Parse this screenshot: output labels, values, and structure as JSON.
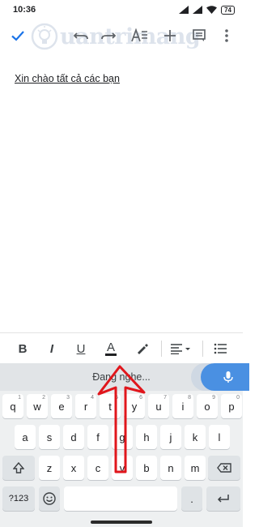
{
  "status_bar": {
    "time": "10:36",
    "battery": "74",
    "icons": [
      "signal-icon",
      "signal-icon",
      "wifi-icon",
      "battery-icon"
    ]
  },
  "toolbar": {
    "icons": [
      "check-icon",
      "undo-icon",
      "redo-icon",
      "text-format-icon",
      "add-icon",
      "comment-icon",
      "more-vert-icon"
    ]
  },
  "watermark": {
    "text": "uantrimang"
  },
  "document": {
    "text": "Xin chào tất cả các bạn"
  },
  "format_bar": {
    "bold": "B",
    "italic": "I",
    "underline": "U",
    "text_color": "A",
    "icons": [
      "highlight-pen-icon",
      "align-icon",
      "list-icon"
    ]
  },
  "keyboard": {
    "voice_status": "Đang nghe...",
    "row1": [
      {
        "key": "q",
        "hint": "1"
      },
      {
        "key": "w",
        "hint": "2"
      },
      {
        "key": "e",
        "hint": "3"
      },
      {
        "key": "r",
        "hint": "4"
      },
      {
        "key": "t",
        "hint": "5"
      },
      {
        "key": "y",
        "hint": "6"
      },
      {
        "key": "u",
        "hint": "7"
      },
      {
        "key": "i",
        "hint": "8"
      },
      {
        "key": "o",
        "hint": "9"
      },
      {
        "key": "p",
        "hint": "0"
      }
    ],
    "row2": [
      "a",
      "s",
      "d",
      "f",
      "g",
      "h",
      "j",
      "k",
      "l"
    ],
    "row3": [
      "z",
      "x",
      "c",
      "v",
      "b",
      "n",
      "m"
    ],
    "symbols_key": "?123",
    "period_key": ".",
    "icons": [
      "mic-icon",
      "shift-icon",
      "backspace-icon",
      "emoji-icon",
      "enter-icon"
    ]
  },
  "colors": {
    "accent": "#1a73e8",
    "mic_bubble": "#4a90e2",
    "arrow": "#e0161c",
    "keyboard_bg": "#eef0f1"
  }
}
